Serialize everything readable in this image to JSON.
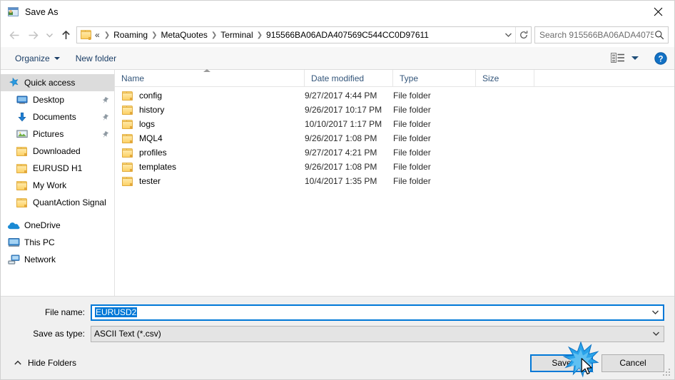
{
  "window": {
    "title": "Save As",
    "icon": "save-as-app-icon",
    "close_icon": "close-icon"
  },
  "nav": {
    "back_icon": "back-arrow-icon",
    "forward_icon": "forward-arrow-icon",
    "recent_icon": "chevron-down-icon",
    "up_icon": "up-arrow-icon",
    "address": {
      "folder_icon": "folder-icon",
      "prefix": "«",
      "crumbs": [
        "Roaming",
        "MetaQuotes",
        "Terminal",
        "915566BA06ADA407569C544CC0D97611"
      ],
      "dropdown_icon": "chevron-down-icon",
      "refresh_icon": "refresh-icon"
    },
    "search": {
      "placeholder": "Search 915566BA06ADA40756...",
      "icon": "search-icon"
    }
  },
  "toolbar": {
    "organize_label": "Organize",
    "new_folder_label": "New folder",
    "view_icon": "view-layout-icon",
    "help_icon": "help-icon"
  },
  "sidebar": {
    "items": [
      {
        "label": "Quick access",
        "icon": "star-icon",
        "selected": true,
        "indent": false,
        "pinned": false
      },
      {
        "label": "Desktop",
        "icon": "desktop-icon",
        "selected": false,
        "indent": true,
        "pinned": true
      },
      {
        "label": "Documents",
        "icon": "download-arrow-icon",
        "selected": false,
        "indent": true,
        "pinned": true
      },
      {
        "label": "Pictures",
        "icon": "pictures-icon",
        "selected": false,
        "indent": true,
        "pinned": true
      },
      {
        "label": "Downloaded",
        "icon": "folder-icon",
        "selected": false,
        "indent": true,
        "pinned": false
      },
      {
        "label": "EURUSD H1",
        "icon": "folder-icon",
        "selected": false,
        "indent": true,
        "pinned": false
      },
      {
        "label": "My Work",
        "icon": "folder-icon",
        "selected": false,
        "indent": true,
        "pinned": false
      },
      {
        "label": "QuantAction Signal",
        "icon": "folder-icon",
        "selected": false,
        "indent": true,
        "pinned": false
      },
      {
        "label": "OneDrive",
        "icon": "onedrive-icon",
        "selected": false,
        "indent": false,
        "pinned": false
      },
      {
        "label": "This PC",
        "icon": "this-pc-icon",
        "selected": false,
        "indent": false,
        "pinned": false
      },
      {
        "label": "Network",
        "icon": "network-icon",
        "selected": false,
        "indent": false,
        "pinned": false
      }
    ]
  },
  "filelist": {
    "columns": [
      "Name",
      "Date modified",
      "Type",
      "Size"
    ],
    "sort_column": "Name",
    "sort_direction": "ascending",
    "rows": [
      {
        "name": "config",
        "date": "9/27/2017 4:44 PM",
        "type": "File folder",
        "size": ""
      },
      {
        "name": "history",
        "date": "9/26/2017 10:17 PM",
        "type": "File folder",
        "size": ""
      },
      {
        "name": "logs",
        "date": "10/10/2017 1:17 PM",
        "type": "File folder",
        "size": ""
      },
      {
        "name": "MQL4",
        "date": "9/26/2017 1:08 PM",
        "type": "File folder",
        "size": ""
      },
      {
        "name": "profiles",
        "date": "9/27/2017 4:21 PM",
        "type": "File folder",
        "size": ""
      },
      {
        "name": "templates",
        "date": "9/26/2017 1:08 PM",
        "type": "File folder",
        "size": ""
      },
      {
        "name": "tester",
        "date": "10/4/2017 1:35 PM",
        "type": "File folder",
        "size": ""
      }
    ]
  },
  "form": {
    "filename_label": "File name:",
    "filename_value": "EURUSD2",
    "filetype_label": "Save as type:",
    "filetype_value": "ASCII Text (*.csv)"
  },
  "footer": {
    "hide_folders_label": "Hide Folders",
    "hide_folders_icon": "chevron-up-icon",
    "save_label": "Save",
    "cancel_label": "Cancel"
  },
  "colors": {
    "accent": "#0078d7",
    "selection": "#0078d7",
    "sidebar_selected": "#dcdcdc",
    "header_text": "#33557a",
    "toolbar_link": "#1a3d66",
    "folder_yellow": "#fcd977",
    "dialog_bg": "#f0f0f0"
  }
}
